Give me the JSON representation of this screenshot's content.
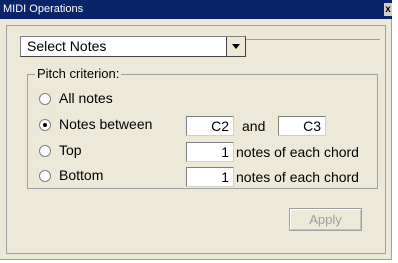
{
  "window": {
    "title": "MIDI Operations",
    "close_glyph": "x"
  },
  "operation": {
    "selected": "Select Notes"
  },
  "pitch": {
    "legend": "Pitch criterion:",
    "options": [
      {
        "label": "All notes",
        "checked": false
      },
      {
        "label": "Notes between",
        "checked": true
      },
      {
        "label": "Top",
        "checked": false
      },
      {
        "label": "Bottom",
        "checked": false
      }
    ],
    "between": {
      "low": "C2",
      "and_label": "and",
      "high": "C3"
    },
    "top": {
      "count": "1",
      "suffix": "notes of each chord"
    },
    "bottom": {
      "count": "1",
      "suffix": "notes of each chord"
    }
  },
  "buttons": {
    "apply": "Apply",
    "apply_enabled": false
  }
}
